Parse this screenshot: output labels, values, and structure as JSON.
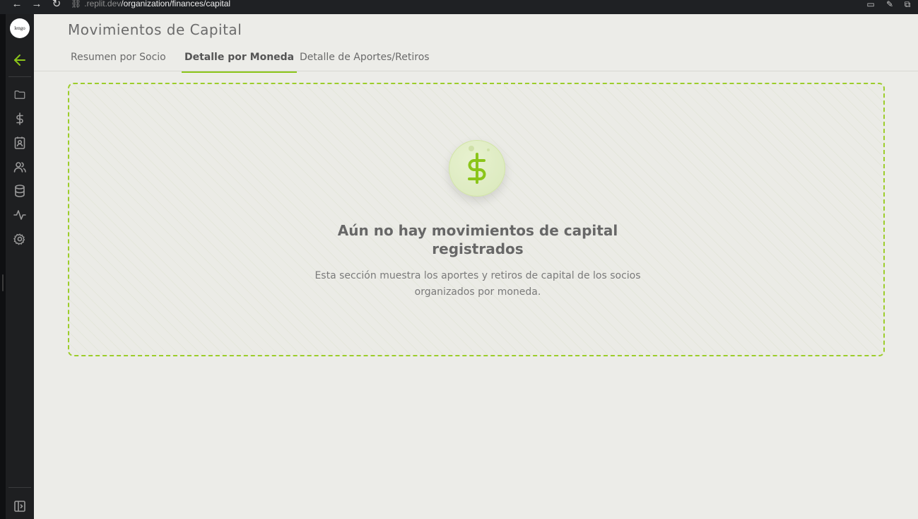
{
  "browser": {
    "back_icon": "arrow-left-icon",
    "forward_icon": "arrow-right-icon",
    "reload_icon": "reload-icon",
    "url_host": ".replit.dev",
    "url_path": "/organization/finances/capital"
  },
  "sidebar": {
    "logo_text": "lengo",
    "accent_color": "#8bc51a",
    "items": [
      {
        "icon": "arrow-left-icon"
      },
      {
        "icon": "folder-icon"
      },
      {
        "icon": "dollar-icon"
      },
      {
        "icon": "contact-card-icon"
      },
      {
        "icon": "users-icon"
      },
      {
        "icon": "database-icon"
      },
      {
        "icon": "activity-icon"
      },
      {
        "icon": "settings-icon"
      },
      {
        "icon": "panel-toggle-icon"
      }
    ]
  },
  "page": {
    "title": "Movimientos de Capital"
  },
  "tabs": [
    {
      "label": "Resumen por Socio",
      "active": false
    },
    {
      "label": "Detalle por Moneda",
      "active": true
    },
    {
      "label": "Detalle de Aportes/Retiros",
      "active": false
    }
  ],
  "empty_state": {
    "icon": "dollar-coin-icon",
    "title": "Aún no hay movimientos de capital registrados",
    "description": "Esta sección muestra los aportes y retiros de capital de los socios organizados por moneda."
  }
}
